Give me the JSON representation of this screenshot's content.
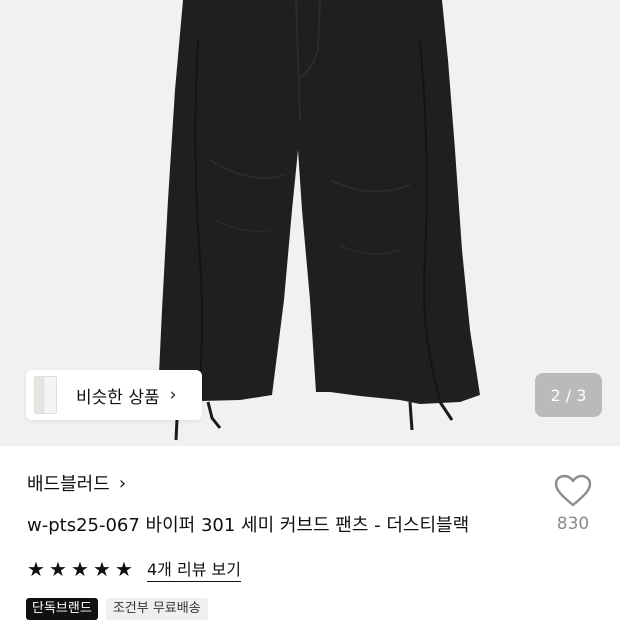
{
  "gallery": {
    "counter": "2 / 3",
    "similar_label": "비슷한 상품",
    "similar_chevron": "›"
  },
  "product": {
    "brand": "배드블러드",
    "brand_chevron": "›",
    "title": "w-pts25-067 바이퍼 301 세미 커브드 팬츠 - 더스티블랙",
    "like_count": "830",
    "rating_stars": 5,
    "review_link": "4개 리뷰 보기"
  },
  "badges": {
    "exclusive": "단독브랜드",
    "shipping": "조건부 무료배송"
  },
  "colors": {
    "pants": "#1e1e1e",
    "hero_bg": "#f1f1f0"
  }
}
